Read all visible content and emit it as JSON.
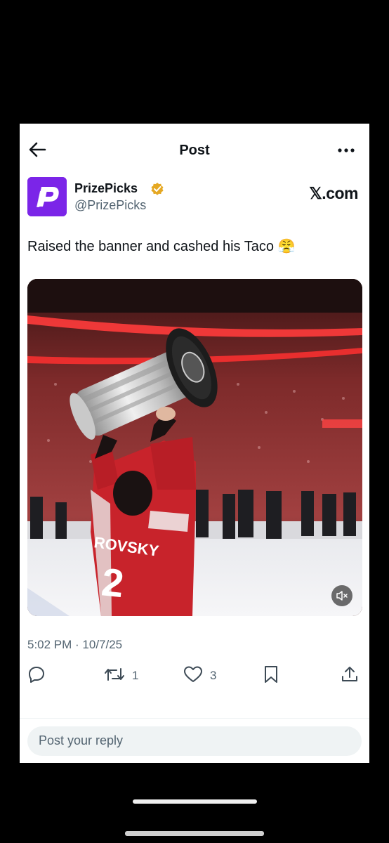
{
  "header": {
    "title": "Post",
    "back_icon": "arrow-left-icon",
    "more_icon": "more-horizontal-icon"
  },
  "author": {
    "display_name": "PrizePicks",
    "handle": "@PrizePicks",
    "verified": true,
    "verified_color": "#e5a823",
    "avatar_color": "#7b25e8",
    "source": "𝕏.com"
  },
  "tweet": {
    "text": "Raised the banner and cashed his Taco 😤",
    "media": {
      "description_icon": "video-media",
      "mute_icon": "volume-muted-icon"
    },
    "timestamp": "5:02 PM · 10/7/25"
  },
  "actions": {
    "reply_icon": "reply-icon",
    "retweet_icon": "retweet-icon",
    "retweet_count": "1",
    "like_icon": "heart-icon",
    "like_count": "3",
    "bookmark_icon": "bookmark-icon",
    "share_icon": "share-icon"
  },
  "reply": {
    "placeholder": "Post your reply"
  }
}
